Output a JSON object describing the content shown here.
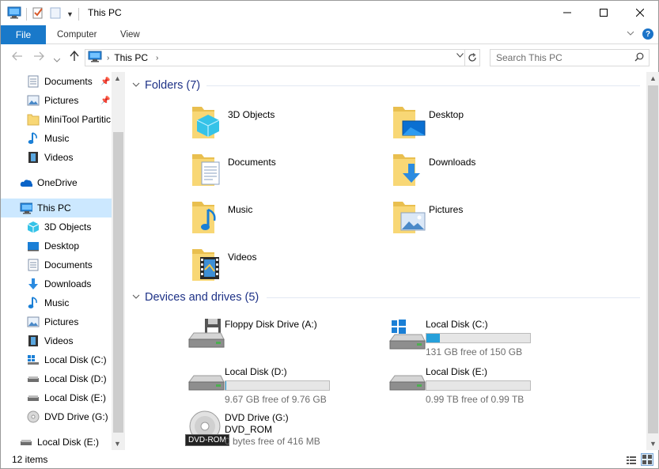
{
  "window": {
    "title": "This PC"
  },
  "ribbon": {
    "tabs": [
      "File",
      "Computer",
      "View"
    ]
  },
  "address": {
    "crumb": "This PC"
  },
  "search": {
    "placeholder": "Search This PC"
  },
  "nav": {
    "items": [
      {
        "label": "Documents",
        "icon": "documents-icon",
        "pinned": true
      },
      {
        "label": "Pictures",
        "icon": "pictures-icon",
        "pinned": true
      },
      {
        "label": "MiniTool Partitic",
        "icon": "folder-icon",
        "pinned": false
      },
      {
        "label": "Music",
        "icon": "music-icon",
        "pinned": false
      },
      {
        "label": "Videos",
        "icon": "videos-icon",
        "pinned": false
      },
      {
        "label": "OneDrive",
        "icon": "onedrive-icon",
        "pinned": false
      },
      {
        "label": "This PC",
        "icon": "computer-icon",
        "pinned": false,
        "selected": true
      },
      {
        "label": "3D Objects",
        "icon": "3d-objects-icon",
        "pinned": false
      },
      {
        "label": "Desktop",
        "icon": "desktop-icon",
        "pinned": false
      },
      {
        "label": "Documents",
        "icon": "documents-icon",
        "pinned": false
      },
      {
        "label": "Downloads",
        "icon": "downloads-icon",
        "pinned": false
      },
      {
        "label": "Music",
        "icon": "music-icon",
        "pinned": false
      },
      {
        "label": "Pictures",
        "icon": "pictures-icon",
        "pinned": false
      },
      {
        "label": "Videos",
        "icon": "videos-icon",
        "pinned": false
      },
      {
        "label": "Local Disk (C:)",
        "icon": "windows-drive-icon",
        "pinned": false
      },
      {
        "label": "Local Disk (D:)",
        "icon": "drive-icon",
        "pinned": false
      },
      {
        "label": "Local Disk (E:)",
        "icon": "drive-icon",
        "pinned": false
      },
      {
        "label": "DVD Drive (G:) D",
        "icon": "dvd-icon",
        "pinned": false
      },
      {
        "label": "Local Disk (E:)",
        "icon": "drive-icon",
        "pinned": false
      }
    ]
  },
  "folders": {
    "title": "Folders (7)",
    "items": [
      {
        "name": "3D Objects",
        "icon": "3d-objects-folder-icon"
      },
      {
        "name": "Desktop",
        "icon": "desktop-folder-icon"
      },
      {
        "name": "Documents",
        "icon": "documents-folder-icon"
      },
      {
        "name": "Downloads",
        "icon": "downloads-folder-icon"
      },
      {
        "name": "Music",
        "icon": "music-folder-icon"
      },
      {
        "name": "Pictures",
        "icon": "pictures-folder-icon"
      },
      {
        "name": "Videos",
        "icon": "videos-folder-icon"
      }
    ]
  },
  "devices": {
    "title": "Devices and drives (5)",
    "floppy": {
      "name": "Floppy Disk Drive (A:)"
    },
    "c": {
      "name": "Local Disk (C:)",
      "free": "131 GB free of 150 GB",
      "used_fraction": 0.127
    },
    "d": {
      "name": "Local Disk (D:)",
      "free": "9.67 GB free of 9.76 GB",
      "used_fraction": 0.009
    },
    "e": {
      "name": "Local Disk (E:)",
      "free": "0.99 TB free of 0.99 TB",
      "used_fraction": 0.0
    },
    "g": {
      "name": "DVD Drive (G:)",
      "label": "DVD_ROM",
      "free": "0 bytes free of 416 MB",
      "badge": "DVD-ROM"
    }
  },
  "status": {
    "count": "12 items"
  },
  "colors": {
    "accent": "#1979ca",
    "bar_fill": "#26a0da",
    "group_title": "#1e3287",
    "selected": "#cce8ff"
  }
}
